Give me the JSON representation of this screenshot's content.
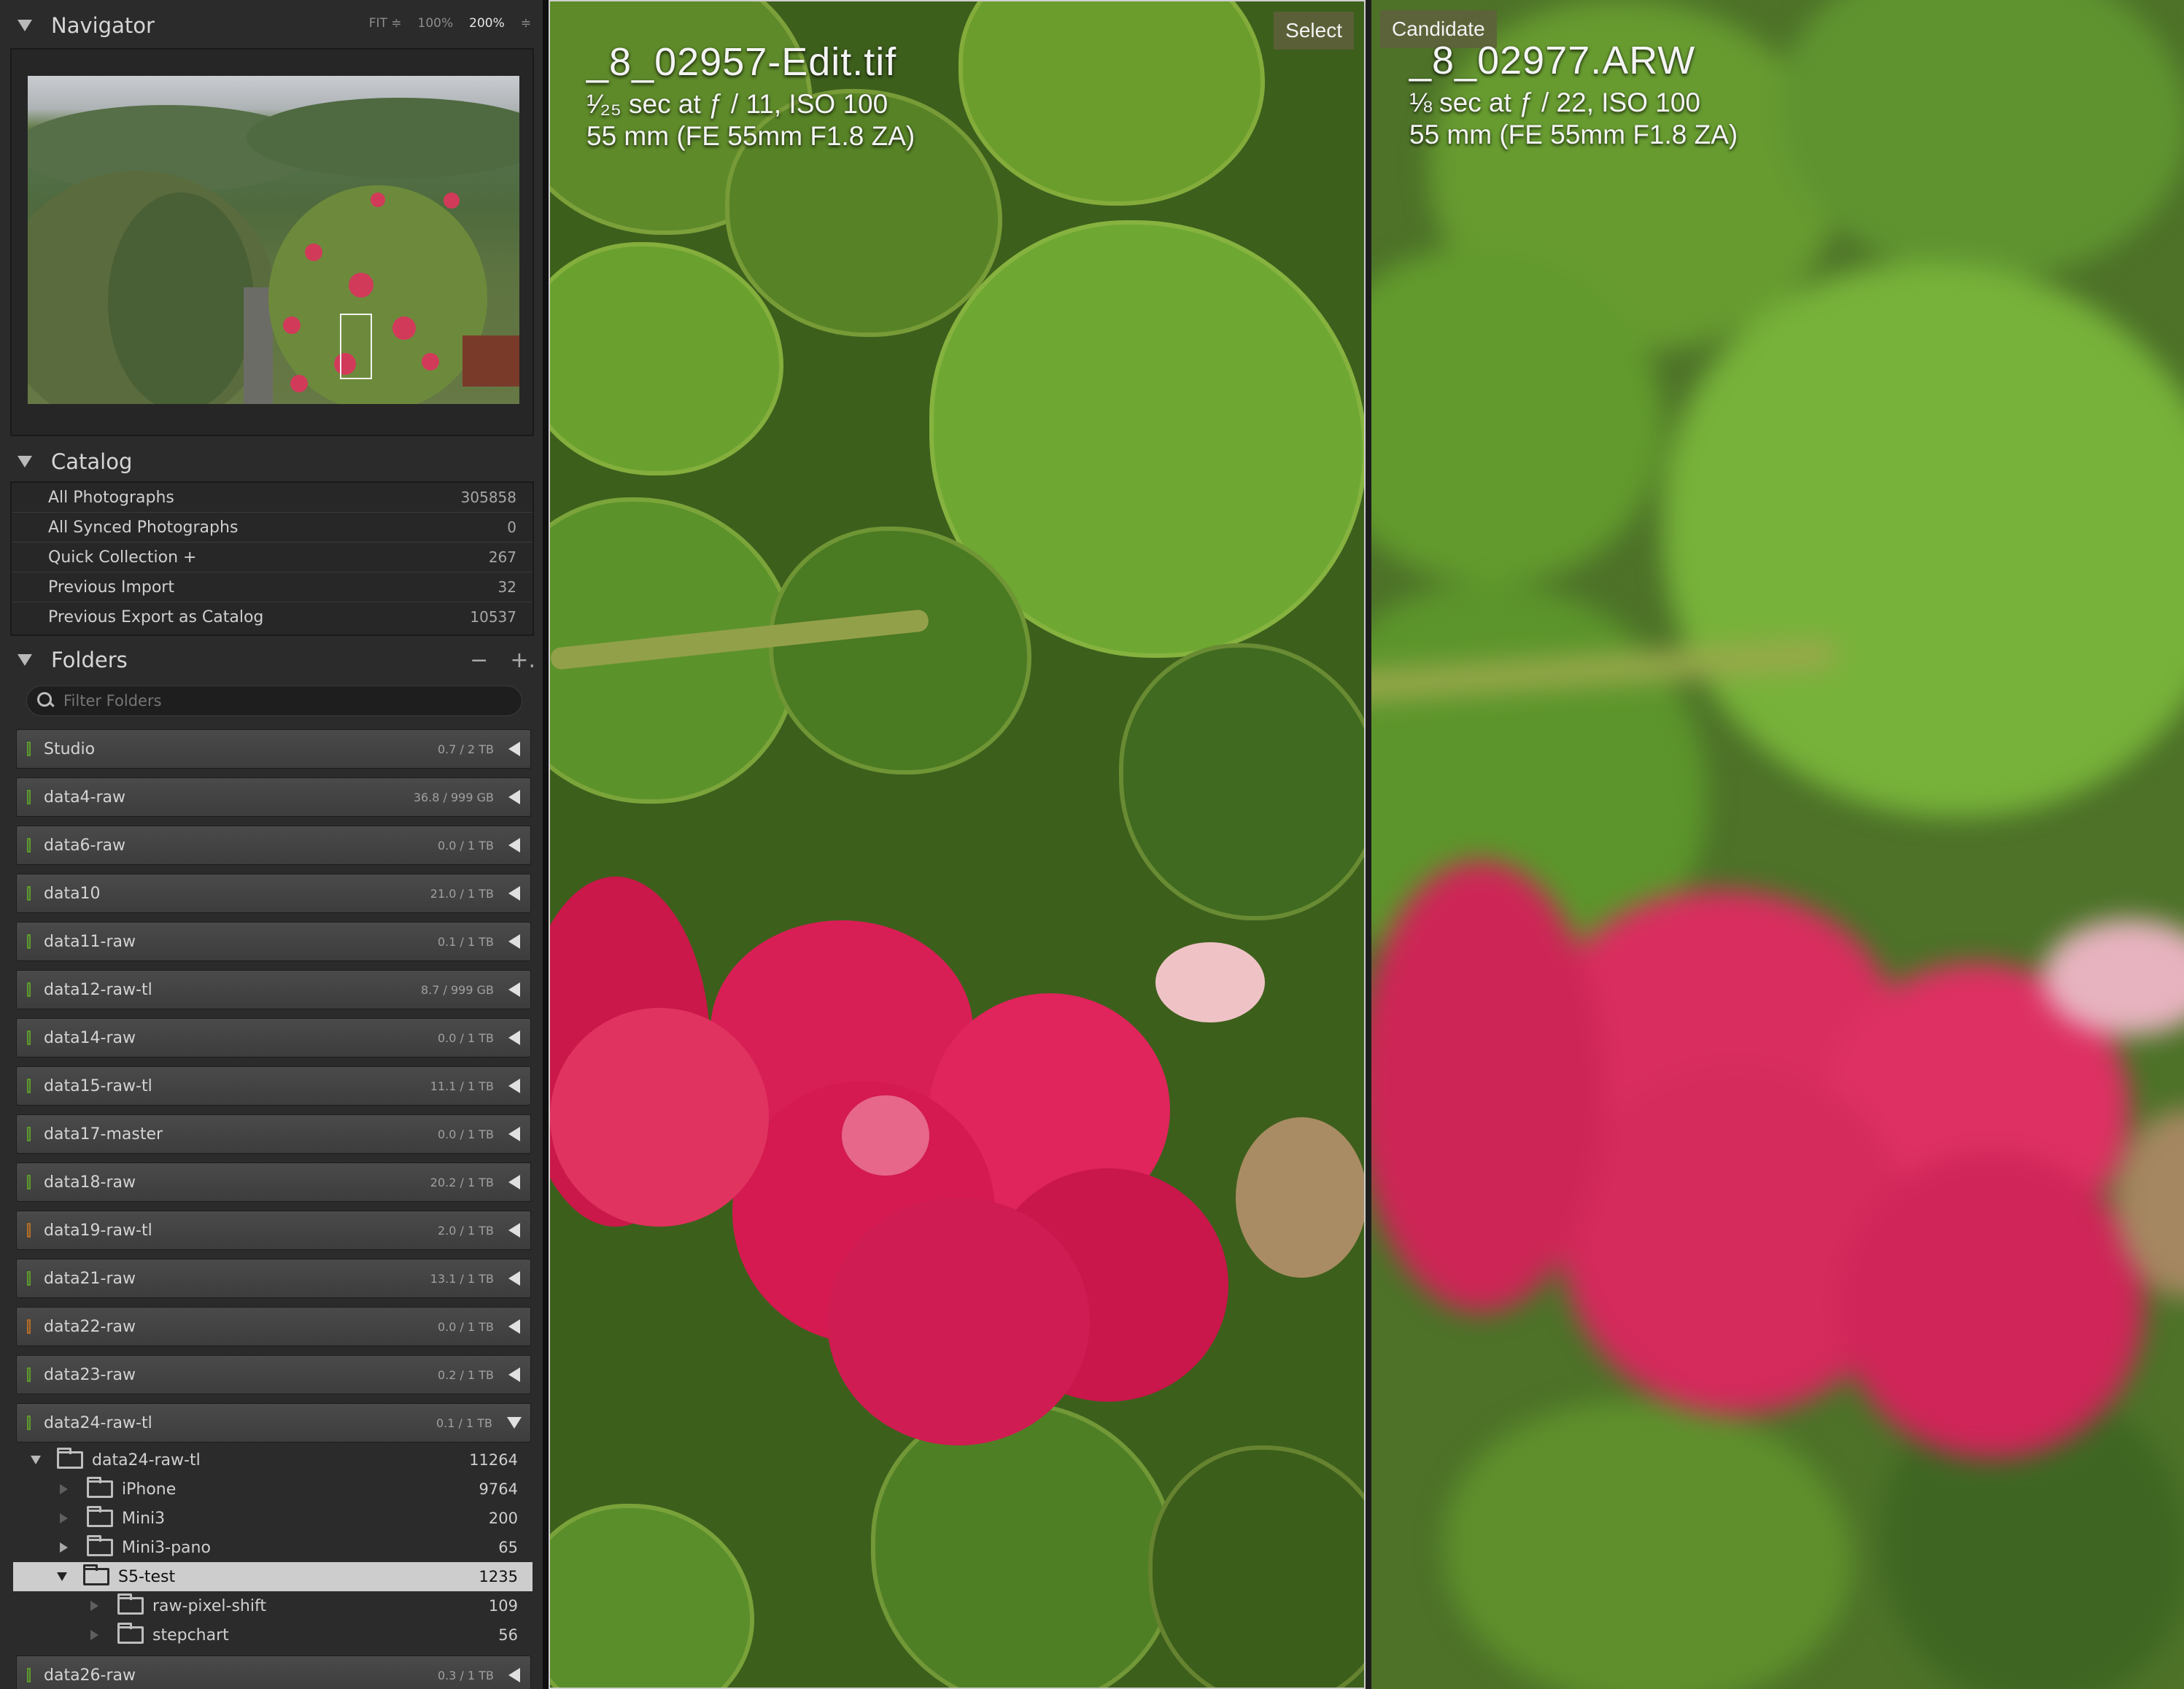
{
  "navigator": {
    "title": "Navigator",
    "zoom": [
      "FIT ≑",
      "100%",
      "200%",
      "≑"
    ],
    "selected_zoom": "200%"
  },
  "catalog": {
    "title": "Catalog",
    "rows": [
      {
        "label": "All Photographs",
        "count": "305858"
      },
      {
        "label": "All Synced Photographs",
        "count": "0"
      },
      {
        "label": "Quick Collection  +",
        "count": "267"
      },
      {
        "label": "Previous Import",
        "count": "32"
      },
      {
        "label": "Previous Export as Catalog",
        "count": "10537"
      }
    ]
  },
  "folders": {
    "title": "Folders",
    "controls": [
      "−",
      "+."
    ],
    "filter_placeholder": "Filter Folders",
    "volumes": [
      {
        "name": "Studio",
        "capacity": "0.7 / 2 TB",
        "led": "green"
      },
      {
        "name": "data4-raw",
        "capacity": "36.8 / 999 GB",
        "led": "green"
      },
      {
        "name": "data6-raw",
        "capacity": "0.0 / 1 TB",
        "led": "green"
      },
      {
        "name": "data10",
        "capacity": "21.0 / 1 TB",
        "led": "green"
      },
      {
        "name": "data11-raw",
        "capacity": "0.1 / 1 TB",
        "led": "green"
      },
      {
        "name": "data12-raw-tl",
        "capacity": "8.7 / 999 GB",
        "led": "green"
      },
      {
        "name": "data14-raw",
        "capacity": "0.0 / 1 TB",
        "led": "green"
      },
      {
        "name": "data15-raw-tl",
        "capacity": "11.1 / 1 TB",
        "led": "green"
      },
      {
        "name": "data17-master",
        "capacity": "0.0 / 1 TB",
        "led": "green"
      },
      {
        "name": "data18-raw",
        "capacity": "20.2 / 1 TB",
        "led": "green"
      },
      {
        "name": "data19-raw-tl",
        "capacity": "2.0 / 1 TB",
        "led": "orange"
      },
      {
        "name": "data21-raw",
        "capacity": "13.1 / 1 TB",
        "led": "green"
      },
      {
        "name": "data22-raw",
        "capacity": "0.0 / 1 TB",
        "led": "orange"
      },
      {
        "name": "data23-raw",
        "capacity": "0.2 / 1 TB",
        "led": "green"
      },
      {
        "name": "data24-raw-tl",
        "capacity": "0.1 / 1 TB",
        "led": "green"
      }
    ],
    "tree": [
      {
        "name": "data24-raw-tl",
        "count": "11264"
      },
      {
        "name": "iPhone",
        "count": "9764"
      },
      {
        "name": "Mini3",
        "count": "200"
      },
      {
        "name": "Mini3-pano",
        "count": "65"
      },
      {
        "name": "S5-test",
        "count": "1235"
      },
      {
        "name": "raw-pixel-shift",
        "count": "109"
      },
      {
        "name": "stepchart",
        "count": "56"
      }
    ],
    "last_volume": {
      "name": "data26-raw",
      "capacity": "0.3 / 1 TB",
      "led": "green"
    }
  },
  "compare": {
    "select": {
      "badge": "Select",
      "filename": "_8_02957-Edit.tif",
      "exposure": "¹⁄₂₅ sec at ƒ / 11, ISO 100",
      "lens": "55 mm (FE 55mm F1.8 ZA)"
    },
    "candidate": {
      "badge": "Candidate",
      "filename": "_8_02977.ARW",
      "exposure": "⅛ sec at ƒ / 22, ISO 100",
      "lens": "55 mm (FE 55mm F1.8 ZA)"
    }
  },
  "icons": [
    "disclosure-triangle-icon",
    "search-icon",
    "folder-icon",
    "volume-led-icon",
    "collapse-arrow-icon"
  ]
}
